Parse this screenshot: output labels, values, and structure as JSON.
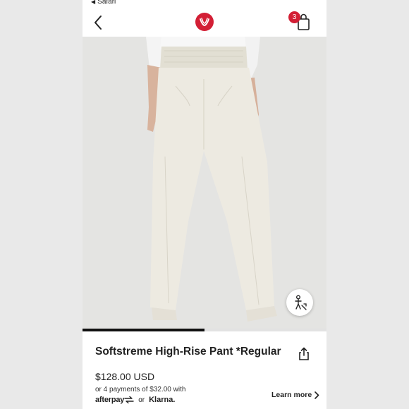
{
  "status_bar": {
    "back_app": "Safari"
  },
  "header": {
    "cart_count": "3",
    "logo_icon": "lululemon-logo-icon"
  },
  "product": {
    "title": "Softstreme High-Rise Pant *Regular",
    "price": "$128.00 USD",
    "installments": "or 4 payments of $32.00 with",
    "afterpay": "afterpay",
    "or": "or",
    "klarna": "Klarna.",
    "learn_more": "Learn more"
  },
  "gallery": {
    "progress": 0.5
  },
  "colors": {
    "brand_red": "#d31f35",
    "text": "#222222"
  }
}
